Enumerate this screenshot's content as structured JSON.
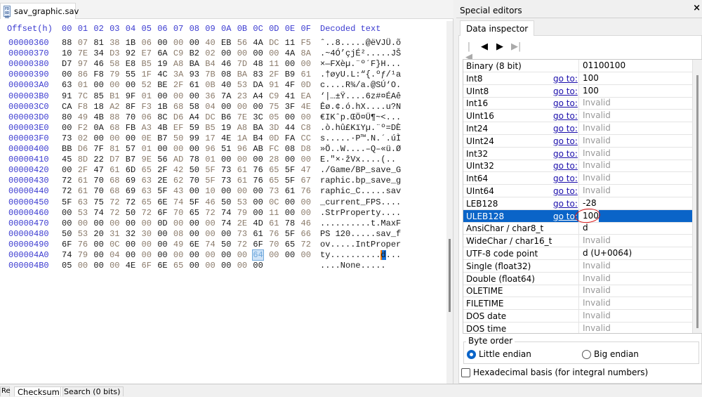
{
  "file_tab": {
    "title": "sav_graphic.sav",
    "icon": "file-icon"
  },
  "hex_view": {
    "offset_header": "Offset(h)",
    "column_headers": [
      "00",
      "01",
      "02",
      "03",
      "04",
      "05",
      "06",
      "07",
      "08",
      "09",
      "0A",
      "0B",
      "0C",
      "0D",
      "0E",
      "0F"
    ],
    "decoded_header": "Decoded text",
    "rows": [
      {
        "offset": "00000360",
        "bytes": "88 07 81 38 1B 06 00 00 00 40 EB 56 4A DC 11 F5",
        "text": "ˆ..8.....@ëVJÜ.õ"
      },
      {
        "offset": "00000370",
        "bytes": "10 7E 34 D3 92 E7 6A C9 B2 02 00 00 00 00 4A 8A",
        "text": ".~4Ó’çjÉ².....JŠ"
      },
      {
        "offset": "00000380",
        "bytes": "D7 97 46 58 E8 B5 19 A8 BA B4 46 7D 48 11 00 00",
        "text": "×—FXèµ.¨º´F}H..."
      },
      {
        "offset": "00000390",
        "bytes": "00 86 F8 79 55 1F 4C 3A 93 7B 08 BA 83 2F B9 61",
        "text": ".†øyU.L:“{.ºƒ/¹a"
      },
      {
        "offset": "000003A0",
        "bytes": "63 01 00 00 00 52 BE 2F 61 0B 40 53 DA 91 4F 0D",
        "text": "c....R¾/a.@SÚ‘O."
      },
      {
        "offset": "000003B0",
        "bytes": "91 7C 85 B1 9F 01 00 00 00 36 7A 23 A4 C9 41 EA",
        "text": "‘|…±Ÿ....6z#¤ÉAê"
      },
      {
        "offset": "000003C0",
        "bytes": "CA F8 18 A2 8F F3 1B 68 58 04 00 00 00 75 3F 4E",
        "text": "Êø.¢.ó.hX....u?N"
      },
      {
        "offset": "000003D0",
        "bytes": "80 49 4B 88 70 06 8C D6 A4 DC B6 7E 3C 05 00 00",
        "text": "€IKˆp.ŒÖ¤Ü¶~<..."
      },
      {
        "offset": "000003E0",
        "bytes": "00 F2 0A 68 FB A3 4B EF 59 B5 19 A8 BA 3D 44 C8",
        "text": ".ò.hû£KïYµ.¨º=DÈ"
      },
      {
        "offset": "000003F0",
        "bytes": "73 02 00 00 00 0E B7 50 99 17 4E 1A B4 0D FA CC",
        "text": "s.....·P™.N.´.úÌ"
      },
      {
        "offset": "00000400",
        "bytes": "BB D6 7F 81 57 01 00 00 00 96 51 96 AB FC 08 D8",
        "text": "»Ö..W....–Q–«ü.Ø"
      },
      {
        "offset": "00000410",
        "bytes": "45 8D 22 D7 B7 9E 56 AD 78 01 00 00 00 28 00 00",
        "text": "E.\"×·žV­x....(.."
      },
      {
        "offset": "00000420",
        "bytes": "00 2F 47 61 6D 65 2F 42 50 5F 73 61 76 65 5F 47",
        "text": "./Game/BP_save_G"
      },
      {
        "offset": "00000430",
        "bytes": "72 61 70 68 69 63 2E 62 70 5F 73 61 76 65 5F 67",
        "text": "raphic.bp_save_g"
      },
      {
        "offset": "00000440",
        "bytes": "72 61 70 68 69 63 5F 43 00 10 00 00 00 73 61 76",
        "text": "raphic_C.....sav"
      },
      {
        "offset": "00000450",
        "bytes": "5F 63 75 72 72 65 6E 74 5F 46 50 53 00 0C 00 00",
        "text": "_current_FPS...."
      },
      {
        "offset": "00000460",
        "bytes": "00 53 74 72 50 72 6F 70 65 72 74 79 00 11 00 00",
        "text": ".StrProperty...."
      },
      {
        "offset": "00000470",
        "bytes": "00 00 00 00 00 00 0D 00 00 00 74 2E 4D 61 78 46",
        "text": "..........t.MaxF"
      },
      {
        "offset": "00000480",
        "bytes": "50 53 20 31 32 30 00 08 00 00 00 73 61 76 5F 66",
        "text": "PS 120.....sav_f"
      },
      {
        "offset": "00000490",
        "bytes": "6F 76 00 0C 00 00 00 49 6E 74 50 72 6F 70 65 72",
        "text": "ov.....IntProper"
      },
      {
        "offset": "000004A0",
        "bytes": "74 79 00 04 00 00 00 00 00 00 00 00 64 00 00 00",
        "text": "ty..........d..."
      },
      {
        "offset": "000004B0",
        "bytes": "05 00 00 00 4E 6F 6E 65 00 00 00 00 00",
        "text": "....None....."
      }
    ]
  },
  "special_editors": {
    "title": "Special editors",
    "close": "×",
    "tab": "Data inspector",
    "nav_icons": [
      "first-icon",
      "prev-icon",
      "next-icon",
      "last-icon"
    ],
    "goto_label": "go to:",
    "rows": [
      {
        "name": "Binary (8 bit)",
        "goto": false,
        "value": "01100100",
        "invalid": false
      },
      {
        "name": "Int8",
        "goto": true,
        "value": "100",
        "invalid": false
      },
      {
        "name": "UInt8",
        "goto": true,
        "value": "100",
        "invalid": false
      },
      {
        "name": "Int16",
        "goto": true,
        "value": "Invalid",
        "invalid": true
      },
      {
        "name": "UInt16",
        "goto": true,
        "value": "Invalid",
        "invalid": true
      },
      {
        "name": "Int24",
        "goto": true,
        "value": "Invalid",
        "invalid": true
      },
      {
        "name": "UInt24",
        "goto": true,
        "value": "Invalid",
        "invalid": true
      },
      {
        "name": "Int32",
        "goto": true,
        "value": "Invalid",
        "invalid": true
      },
      {
        "name": "UInt32",
        "goto": true,
        "value": "Invalid",
        "invalid": true
      },
      {
        "name": "Int64",
        "goto": true,
        "value": "Invalid",
        "invalid": true
      },
      {
        "name": "UInt64",
        "goto": true,
        "value": "Invalid",
        "invalid": true
      },
      {
        "name": "LEB128",
        "goto": true,
        "value": "-28",
        "invalid": false
      },
      {
        "name": "ULEB128",
        "goto": true,
        "value": "100",
        "invalid": false,
        "selected": true
      },
      {
        "name": "AnsiChar / char8_t",
        "goto": false,
        "value": "d",
        "invalid": false
      },
      {
        "name": "WideChar / char16_t",
        "goto": false,
        "value": "Invalid",
        "invalid": true
      },
      {
        "name": "UTF-8 code point",
        "goto": false,
        "value": "d (U+0064)",
        "invalid": false
      },
      {
        "name": "Single (float32)",
        "goto": false,
        "value": "Invalid",
        "invalid": true
      },
      {
        "name": "Double (float64)",
        "goto": false,
        "value": "Invalid",
        "invalid": true
      },
      {
        "name": "OLETIME",
        "goto": false,
        "value": "Invalid",
        "invalid": true
      },
      {
        "name": "FILETIME",
        "goto": false,
        "value": "Invalid",
        "invalid": true
      },
      {
        "name": "DOS date",
        "goto": false,
        "value": "Invalid",
        "invalid": true
      },
      {
        "name": "DOS time",
        "goto": false,
        "value": "Invalid",
        "invalid": true
      }
    ],
    "byte_order": {
      "label": "Byte order",
      "little": "Little endian",
      "big": "Big endian",
      "selected": "little"
    },
    "hex_basis": {
      "label": "Hexadecimal basis (for integral numbers)",
      "checked": false
    },
    "annotation_color": "#d81010"
  },
  "bottom_tabs": [
    "Re",
    "Checksum",
    "Search (0 bits)"
  ]
}
